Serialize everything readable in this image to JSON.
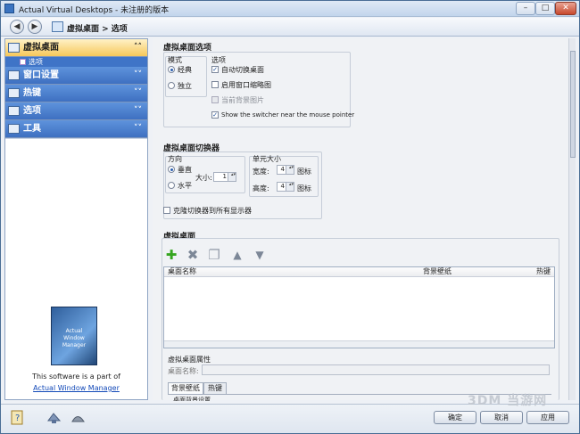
{
  "window": {
    "title": "Actual Virtual Desktops - 未注册的版本",
    "buttons": {
      "minimize": "–",
      "maximize": "□",
      "close": "✕"
    }
  },
  "nav": {
    "back": "◀",
    "forward": "▶",
    "breadcrumb": "虚拟桌面 > 选项"
  },
  "sidebar": {
    "sections": [
      {
        "label": "虚拟桌面",
        "chevron": "˄˄",
        "state": "active"
      },
      {
        "label": "窗口设置",
        "chevron": "˅˅",
        "state": "collapsed"
      },
      {
        "label": "热键",
        "chevron": "˅˅",
        "state": "collapsed"
      },
      {
        "label": "选项",
        "chevron": "˅˅",
        "state": "collapsed"
      },
      {
        "label": "工具",
        "chevron": "˅˅",
        "state": "collapsed"
      }
    ],
    "sub_item": "选项",
    "promo": {
      "box_label": "Actual\nWindow Manager",
      "text": "This software is a part of",
      "link": "Actual Window Manager"
    }
  },
  "options_section": {
    "title": "虚拟桌面选项",
    "mode_caption": "模式",
    "mode_classic": "经典",
    "mode_independent": "独立",
    "options_caption": "选项",
    "auto_switch": "自动切换桌面",
    "enable_thumbnails": "启用窗口缩略图",
    "current_bg": "当前背景图片",
    "show_switcher": "Show the switcher near the mouse pointer"
  },
  "switcher_section": {
    "title": "虚拟桌面切换器",
    "direction_caption": "方向",
    "vertical": "垂直",
    "horizontal": "水平",
    "size_label": "大小:",
    "size_value": "1",
    "cell_caption": "单元大小",
    "width_label": "宽度:",
    "width_value": "4",
    "height_label": "高度:",
    "height_value": "4",
    "icons_unit": "图标",
    "clone_label": "克隆切换器到所有显示器"
  },
  "desktops_section": {
    "title": "虚拟桌面",
    "toolbar": {
      "add": "✚",
      "remove": "✖",
      "copy": "❐",
      "up": "▲",
      "down": "▼"
    },
    "columns": [
      "桌面名称",
      "背景壁纸",
      "热键"
    ],
    "props_caption": "虚拟桌面属性",
    "name_label": "桌面名称:",
    "name_value": "",
    "tabs": [
      "背景壁纸",
      "热键"
    ],
    "tab_fragment": "桌面背景设置"
  },
  "bottom": {
    "ok": "确定",
    "cancel": "取消",
    "apply": "应用"
  },
  "watermark": "3DM 当游网"
}
